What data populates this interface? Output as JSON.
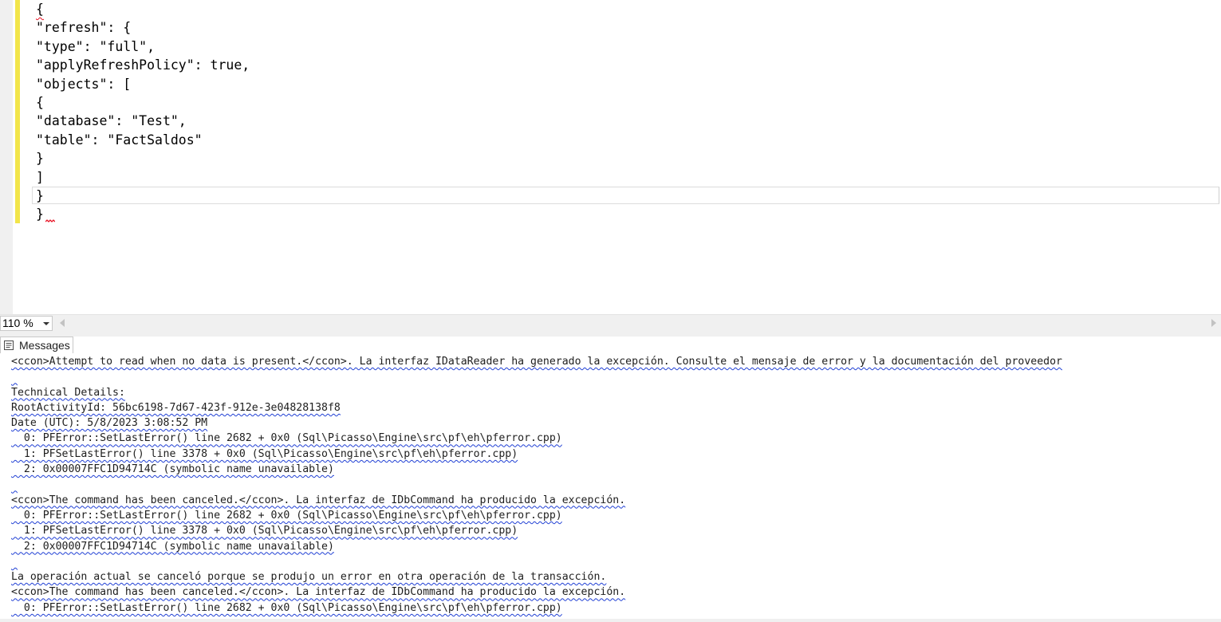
{
  "editor": {
    "code_lines": [
      "{",
      "\"refresh\": {",
      "\"type\": \"full\",",
      "\"applyRefreshPolicy\": true,",
      "\"objects\": [",
      "{",
      "\"database\": \"Test\",",
      "\"table\": \"FactSaldos\"",
      "}",
      "]",
      "}",
      "}"
    ]
  },
  "zoom": {
    "value": "110 %"
  },
  "results": {
    "tab_label": "Messages",
    "message_lines": [
      "<ccon>Attempt to read when no data is present.</ccon>. La interfaz IDataReader ha generado la excepción. Consulte el mensaje de error y la documentación del proveedor",
      "",
      "Technical Details:",
      "RootActivityId: 56bc6198-7d67-423f-912e-3e04828138f8",
      "Date (UTC): 5/8/2023 3:08:52 PM",
      "  0: PFError::SetLastError() line 2682 + 0x0 (Sql\\Picasso\\Engine\\src\\pf\\eh\\pferror.cpp)",
      "  1: PFSetLastError() line 3378 + 0x0 (Sql\\Picasso\\Engine\\src\\pf\\eh\\pferror.cpp)",
      "  2: 0x00007FFC1D94714C (symbolic name unavailable)",
      "",
      "<ccon>The command has been canceled.</ccon>. La interfaz de IDbCommand ha producido la excepción.",
      "  0: PFError::SetLastError() line 2682 + 0x0 (Sql\\Picasso\\Engine\\src\\pf\\eh\\pferror.cpp)",
      "  1: PFSetLastError() line 3378 + 0x0 (Sql\\Picasso\\Engine\\src\\pf\\eh\\pferror.cpp)",
      "  2: 0x00007FFC1D94714C (symbolic name unavailable)",
      "",
      "La operación actual se canceló porque se produjo un error en otra operación de la transacción.",
      "<ccon>The command has been canceled.</ccon>. La interfaz de IDbCommand ha producido la excepción.",
      "  0: PFError::SetLastError() line 2682 + 0x0 (Sql\\Picasso\\Engine\\src\\pf\\eh\\pferror.cpp)"
    ]
  },
  "colors": {
    "change_bar": "#f2e54a",
    "error_squiggle": "#e81123",
    "warning_squiggle": "#1f3fd4"
  },
  "icons": {
    "messages_tab": "messages-icon"
  }
}
